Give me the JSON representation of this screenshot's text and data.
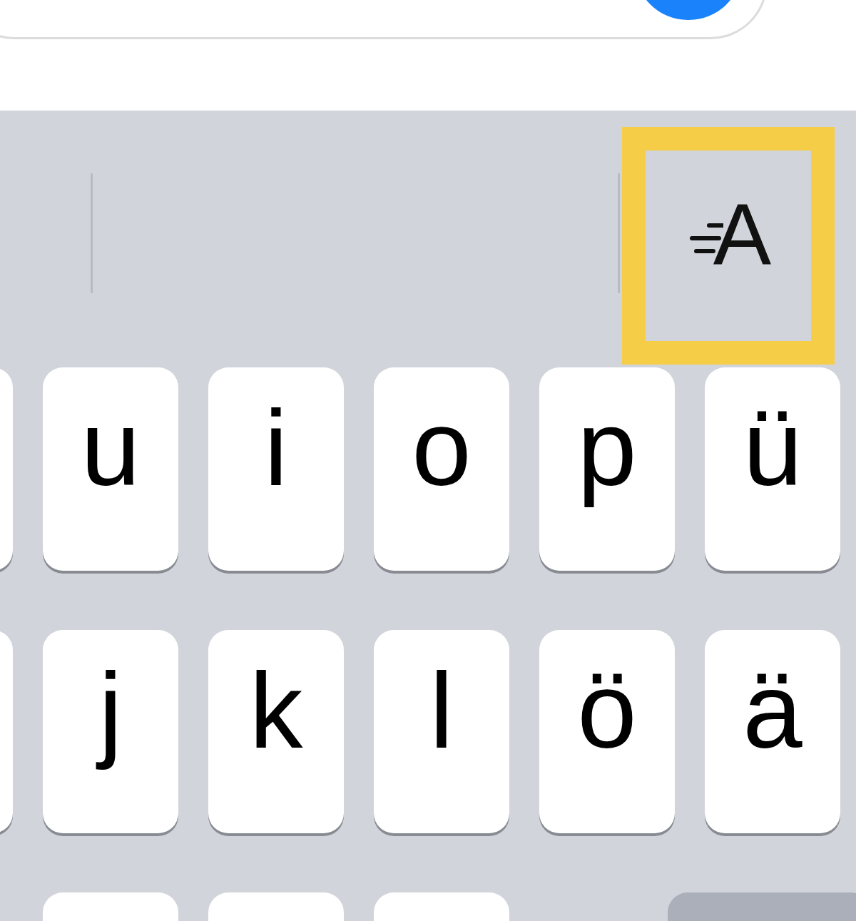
{
  "suggestion_bar": {
    "highlighted": true,
    "format_button": {
      "glyph": "A"
    }
  },
  "rows": [
    {
      "keys": [
        {
          "kind": "letter"
        },
        {
          "kind": "letter",
          "label": "u"
        },
        {
          "kind": "letter",
          "label": "i"
        },
        {
          "kind": "letter",
          "label": "o"
        },
        {
          "kind": "letter",
          "label": "p"
        },
        {
          "kind": "letter",
          "label": "ü"
        }
      ]
    },
    {
      "keys": [
        {
          "kind": "letter"
        },
        {
          "kind": "letter",
          "label": "j"
        },
        {
          "kind": "letter",
          "label": "k"
        },
        {
          "kind": "letter",
          "label": "l"
        },
        {
          "kind": "letter",
          "label": "ö"
        },
        {
          "kind": "letter",
          "label": "ä"
        }
      ]
    },
    {
      "keys": [
        {
          "kind": "gap"
        },
        {
          "kind": "letter"
        },
        {
          "kind": "letter"
        },
        {
          "kind": "letter"
        },
        {
          "kind": "spacer"
        },
        {
          "kind": "function"
        }
      ]
    }
  ]
}
